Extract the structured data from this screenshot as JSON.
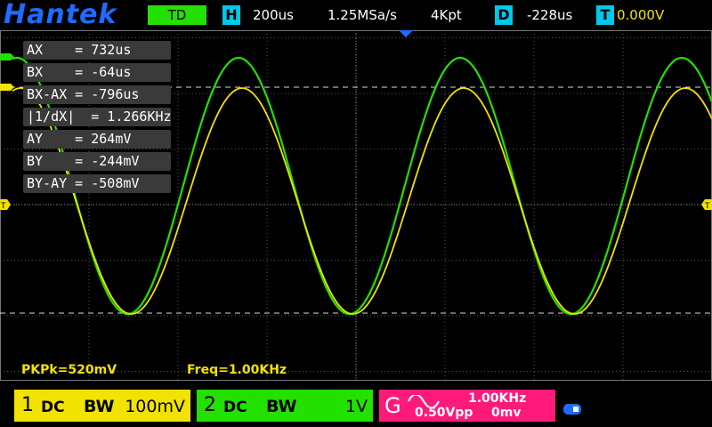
{
  "header": {
    "brand": "Hantek",
    "mode": "TD",
    "timebase_key": "H",
    "timebase": "200us",
    "sample_rate": "1.25MSa/s",
    "memory_depth": "4Kpt",
    "delay_key": "D",
    "delay": "-228us",
    "trigger_key": "T",
    "trigger_level": "0.000V"
  },
  "markers": {
    "trigger_left": "T",
    "trigger_right": "T"
  },
  "cursors": [
    {
      "label": "AX    = 732us"
    },
    {
      "label": "BX    = -64us"
    },
    {
      "label": "BX-AX = -796us"
    },
    {
      "label": "|1/dX|  = 1.266KHz"
    },
    {
      "label": "AY    = 264mV"
    },
    {
      "label": "BY    = -244mV"
    },
    {
      "label": "BY-AY = -508mV"
    }
  ],
  "measurements": {
    "pkpk": "PKPk=520mV",
    "freq": "Freq=1.00KHz"
  },
  "channels": {
    "ch1": {
      "number": "1",
      "coupling": "DC",
      "bw": "BW",
      "scale": "100mV",
      "color": "#f2e200"
    },
    "ch2": {
      "number": "2",
      "coupling": "DC",
      "bw": "BW",
      "scale": "1V",
      "color": "#22e000"
    }
  },
  "generator": {
    "label": "G",
    "frequency": "1.00KHz",
    "amplitude": "0.50Vpp",
    "offset": "0mv",
    "color": "#ff1a7a"
  },
  "colors": {
    "ch1_trace": "#f2e200",
    "ch2_trace": "#22e000",
    "grid": "#7a7a7a",
    "accent_blue": "#1e6cff",
    "cyan": "#00c8e8"
  }
}
